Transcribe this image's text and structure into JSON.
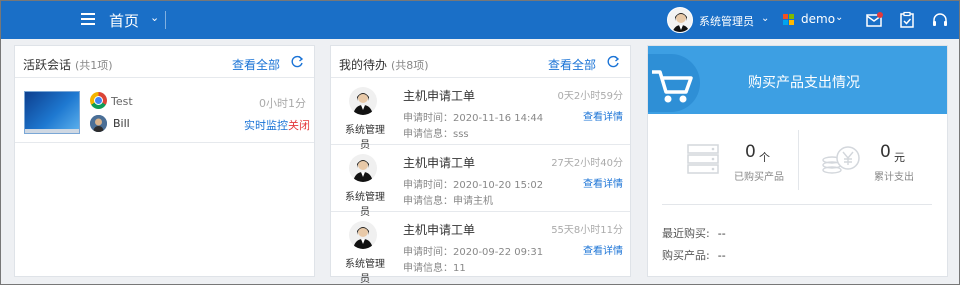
{
  "topbar": {
    "home_label": "首页",
    "user_name": "系统管理员",
    "org_name": "demo"
  },
  "sessions": {
    "title": "活跃会话",
    "count": "(共1项)",
    "view_all": "查看全部",
    "items": [
      {
        "host": "Test",
        "duration": "0小时1分",
        "user": "Bill",
        "monitor": "实时监控",
        "close": "关闭"
      }
    ]
  },
  "todos": {
    "title": "我的待办",
    "count": "(共8项)",
    "view_all": "查看全部",
    "items": [
      {
        "user": "系统管理员",
        "title": "主机申请工单",
        "time": "申请时间：2020-11-16 14:44",
        "info": "申请信息：sss",
        "elapsed": "0天2小时59分",
        "link": "查看详情"
      },
      {
        "user": "系统管理员",
        "title": "主机申请工单",
        "time": "申请时间：2020-10-20 15:02",
        "info": "申请信息：申请主机",
        "elapsed": "27天2小时40分",
        "link": "查看详情"
      },
      {
        "user": "系统管理员",
        "title": "主机申请工单",
        "time": "申请时间：2020-09-22 09:31",
        "info": "申请信息：11",
        "elapsed": "55天8小时11分",
        "link": "查看详情"
      }
    ]
  },
  "purchase": {
    "title": "购买产品支出情况",
    "bought_count": "0",
    "bought_unit": "个",
    "bought_label": "已购买产品",
    "spend_total": "0",
    "spend_unit": "元",
    "spend_label": "累计支出",
    "recent_label": "最近购买:",
    "recent_value": "--",
    "product_label": "购买产品:",
    "product_value": "--"
  },
  "colors": {
    "topbar": "#1a6fc7",
    "link": "#1a73d6",
    "danger": "#e4393c",
    "purchase_header": "#3d9fe3"
  },
  "icons": [
    "menu-icon",
    "chevron-down-icon",
    "windows-logo-icon",
    "mail-icon",
    "clipboard-check-icon",
    "headset-icon",
    "refresh-icon",
    "chrome-icon",
    "shopping-cart-icon",
    "server-stack-icon",
    "yen-coins-icon"
  ]
}
